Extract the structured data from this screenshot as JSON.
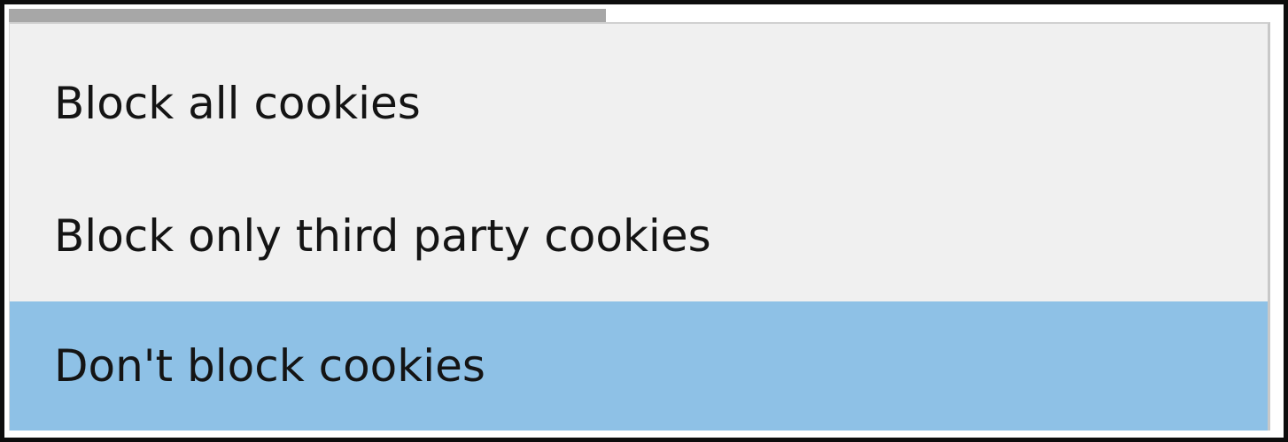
{
  "dropdown": {
    "options": [
      {
        "label": "Block all cookies",
        "selected": false
      },
      {
        "label": "Block only third party cookies",
        "selected": false
      },
      {
        "label": "Don't block cookies",
        "selected": true
      }
    ],
    "highlight_color": "#8ec1e6",
    "background_color": "#f0f0f0"
  }
}
